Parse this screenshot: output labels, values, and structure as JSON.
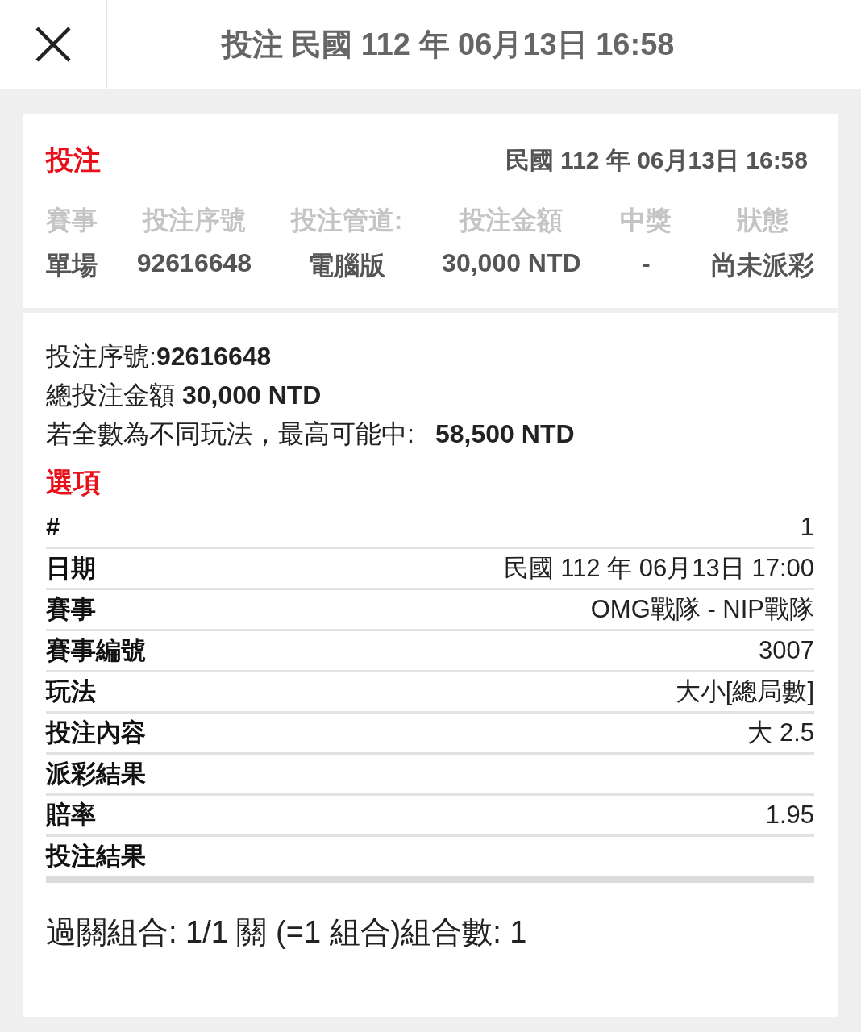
{
  "header": {
    "title": "投注 民國 112 年 06月13日 16:58"
  },
  "summary": {
    "title": "投注",
    "date": "民國 112 年 06月13日 16:58",
    "columns": [
      {
        "label": "賽事",
        "value": "單場"
      },
      {
        "label": "投注序號",
        "value": "92616648"
      },
      {
        "label": "投注管道:",
        "value": "電腦版"
      },
      {
        "label": "投注金額",
        "value": "30,000 NTD"
      },
      {
        "label": "中獎",
        "value": "-"
      },
      {
        "label": "狀態",
        "value": "尚未派彩"
      }
    ]
  },
  "details": {
    "serial_label": "投注序號:",
    "serial": "92616648",
    "total_label": "總投注金額",
    "total": "30,000 NTD",
    "max_label": "若全數為不同玩法，最高可能中:",
    "max": "58,500 NTD"
  },
  "options": {
    "title": "選項",
    "rows": [
      {
        "label": "#",
        "value": "1"
      },
      {
        "label": "日期",
        "value": "民國 112 年 06月13日 17:00"
      },
      {
        "label": "賽事",
        "value": "OMG戰隊 - NIP戰隊"
      },
      {
        "label": "賽事編號",
        "value": "3007"
      },
      {
        "label": "玩法",
        "value": "大小[總局數]"
      },
      {
        "label": "投注內容",
        "value": "大 2.5"
      },
      {
        "label": "派彩結果"
      },
      {
        "label": "賠率",
        "value": "1.95"
      },
      {
        "label": "投注結果"
      }
    ]
  },
  "combo": "過關組合: 1/1 關 (=1 組合)組合數: 1"
}
